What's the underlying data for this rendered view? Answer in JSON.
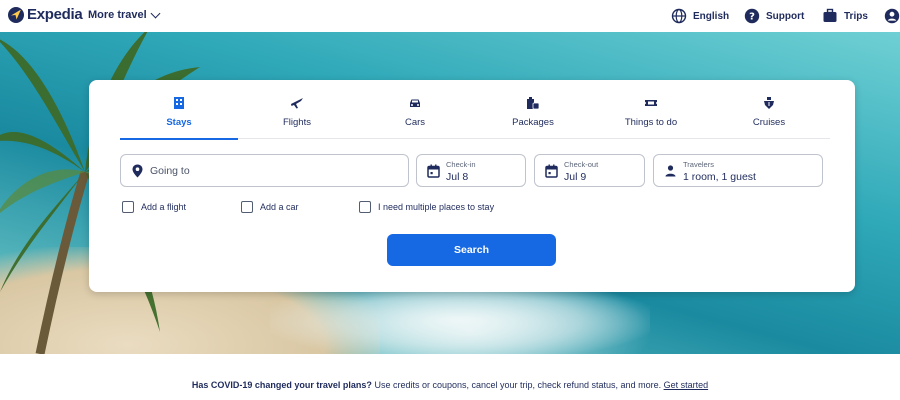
{
  "header": {
    "logo_text": "Expedia",
    "more_travel": "More travel",
    "language": "English",
    "support": "Support",
    "trips": "Trips"
  },
  "tabs": [
    {
      "label": "Stays",
      "icon": "building-icon",
      "active": true
    },
    {
      "label": "Flights",
      "icon": "plane-icon",
      "active": false
    },
    {
      "label": "Cars",
      "icon": "car-icon",
      "active": false
    },
    {
      "label": "Packages",
      "icon": "packages-icon",
      "active": false
    },
    {
      "label": "Things to do",
      "icon": "ticket-icon",
      "active": false
    },
    {
      "label": "Cruises",
      "icon": "ship-icon",
      "active": false
    }
  ],
  "search": {
    "destination_placeholder": "Going to",
    "checkin_label": "Check-in",
    "checkin_value": "Jul 8",
    "checkout_label": "Check-out",
    "checkout_value": "Jul 9",
    "travelers_label": "Travelers",
    "travelers_value": "1 room, 1 guest",
    "options": [
      "Add a flight",
      "Add a car",
      "I need multiple places to stay"
    ],
    "button_label": "Search"
  },
  "banner": {
    "bold_text": "Has COVID-19 changed your travel plans?",
    "text": " Use credits or coupons, cancel your trip, check refund status, and more. ",
    "link": "Get started"
  },
  "colors": {
    "brand_navy": "#1f2b5c",
    "accent_blue": "#1668e3",
    "logo_yellow": "#ffc94c"
  }
}
